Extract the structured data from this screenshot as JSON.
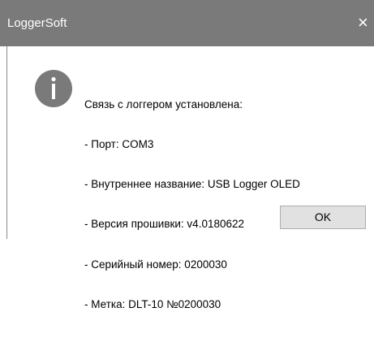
{
  "window": {
    "title": "LoggerSoft",
    "close_glyph": "×"
  },
  "icon": {
    "name": "info-icon",
    "color": "#7a7a7a"
  },
  "message": {
    "lines": [
      "Связь с логгером установлена:",
      "- Порт: COM3",
      "- Внутреннее название: USB Logger OLED",
      "- Версия прошивки: v4.0180622",
      "- Серийный номер: 0200030",
      "- Метка: DLT-10 №0200030"
    ]
  },
  "buttons": {
    "ok_label": "OK"
  },
  "colors": {
    "titlebar": "#7a7a7a",
    "title_text": "#ffffff",
    "button_face": "#e1e1e1",
    "button_border": "#adadad"
  }
}
